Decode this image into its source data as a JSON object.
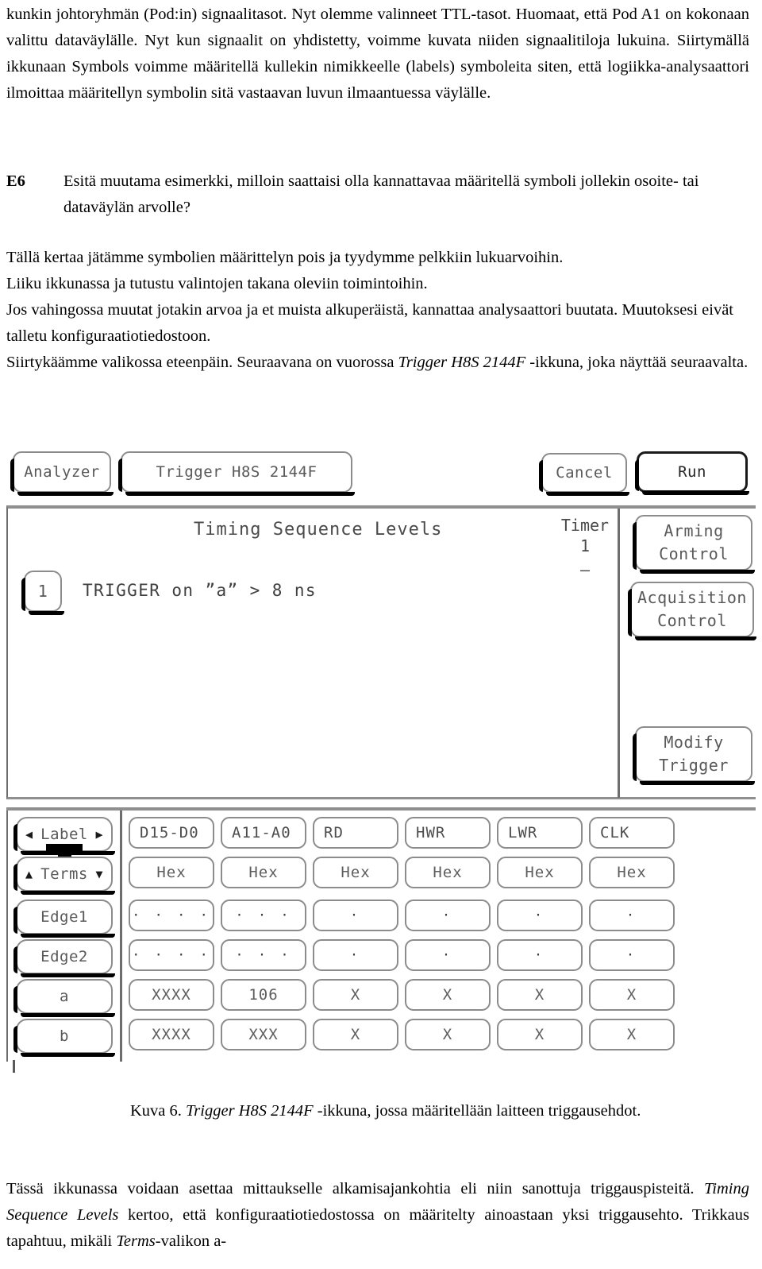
{
  "document": {
    "top_paragraph": "kunkin johtoryhmän (Pod:in) signaalitasot. Nyt olemme valinneet TTL-tasot. Huomaat, että Pod A1 on kokonaan valittu dataväylälle. Nyt kun signaalit on yhdistetty, voimme kuvata niiden signaalitiloja lukuina. Siirtymällä ikkunaan Symbols voimme määritellä kullekin nimikkeelle (labels) symboleita siten, että logiikka-analysaattori ilmoittaa määritellyn symbolin sitä vastaavan luvun ilmaantuessa väylälle.",
    "exercise_tag": "E6",
    "exercise_text": "Esitä muutama esimerkki, milloin saattaisi olla kannattavaa määritellä symboli jollekin osoite- tai dataväylän arvolle?",
    "mid_lines": [
      "Tällä kertaa jätämme symbolien määrittelyn pois ja tyydymme pelkkiin lukuarvoihin.",
      "Liiku ikkunassa ja tutustu valintojen takana oleviin toimintoihin.",
      "Jos vahingossa muutat jotakin arvoa ja et muista alkuperäistä, kannattaa analysaattori buutata. Muutoksesi eivät talletu konfiguraatiotiedostoon."
    ],
    "mid_last_pre": "Siirtykäämme valikossa eteenpäin. Seuraavana on vuorossa ",
    "mid_last_italic": "Trigger H8S 2144F",
    "mid_last_post": " -ikkuna, joka näyttää seuraavalta.",
    "caption_pre": "Kuva 6. ",
    "caption_italic": "Trigger H8S 2144F",
    "caption_post": " -ikkuna, jossa määritellään laitteen triggausehdot.",
    "bottom_pre": "Tässä ikkunassa voidaan asettaa mittaukselle alkamisajankohtia eli niin sanottuja triggauspisteitä. ",
    "bottom_italic_1": "Timing Sequence Levels",
    "bottom_mid": " kertoo, että konfiguraatiotiedostossa on määritelty ainoastaan yksi triggausehto. Trikkaus tapahtuu, mikäli ",
    "bottom_italic_2": "Terms",
    "bottom_post": "-valikon a-"
  },
  "analyzer": {
    "toolbar": {
      "analyzer_label": "Analyzer",
      "window_label": "Trigger  H8S 2144F",
      "cancel_label": "Cancel",
      "run_label": "Run"
    },
    "panel": {
      "sequence_title": "Timing Sequence Levels",
      "timer_label": "Timer",
      "timer_number": "1",
      "timer_dash": "–",
      "level_number": "1",
      "trigger_text": "TRIGGER on ”a” > 8 ns"
    },
    "side_controls": [
      {
        "name": "arming-control",
        "line1": "Arming",
        "line2": "Control"
      },
      {
        "name": "acquisition-control",
        "line1": "Acquisition",
        "line2": "Control"
      },
      {
        "name": "modify-trigger",
        "line1": "Modify",
        "line2": "Trigger"
      }
    ],
    "nav": {
      "label_button": "Label",
      "label_left_arrow": "◀",
      "label_right_arrow": "▶",
      "terms_button": "Terms",
      "terms_up_arrow": "▲",
      "terms_down_arrow": "▼"
    },
    "matrix": {
      "row_labels": [
        "Edge1",
        "Edge2",
        "a",
        "b"
      ],
      "columns": [
        "D15-D0",
        "A11-A0",
        "RD",
        "HWR",
        "LWR",
        "CLK"
      ],
      "base_row": [
        "Hex",
        "Hex",
        "Hex",
        "Hex",
        "Hex",
        "Hex"
      ],
      "rows": [
        {
          "label": "Edge1",
          "values": [
            "· · · ·",
            "· · ·",
            "·",
            "·",
            "·",
            "·"
          ]
        },
        {
          "label": "Edge2",
          "values": [
            "· · · ·",
            "· · ·",
            "·",
            "·",
            "·",
            "·"
          ]
        },
        {
          "label": "a",
          "values": [
            "XXXX",
            "106",
            "X",
            "X",
            "X",
            "X"
          ]
        },
        {
          "label": "b",
          "values": [
            "XXXX",
            "XXX",
            "X",
            "X",
            "X",
            "X"
          ]
        }
      ]
    },
    "colors": {
      "button_border": "#8c8c8c",
      "button_text": "#595959",
      "highlight_border": "#1a1a1a",
      "panel_rule": "#8f8f8f",
      "shadow": "#000000",
      "background": "#ffffff"
    }
  }
}
